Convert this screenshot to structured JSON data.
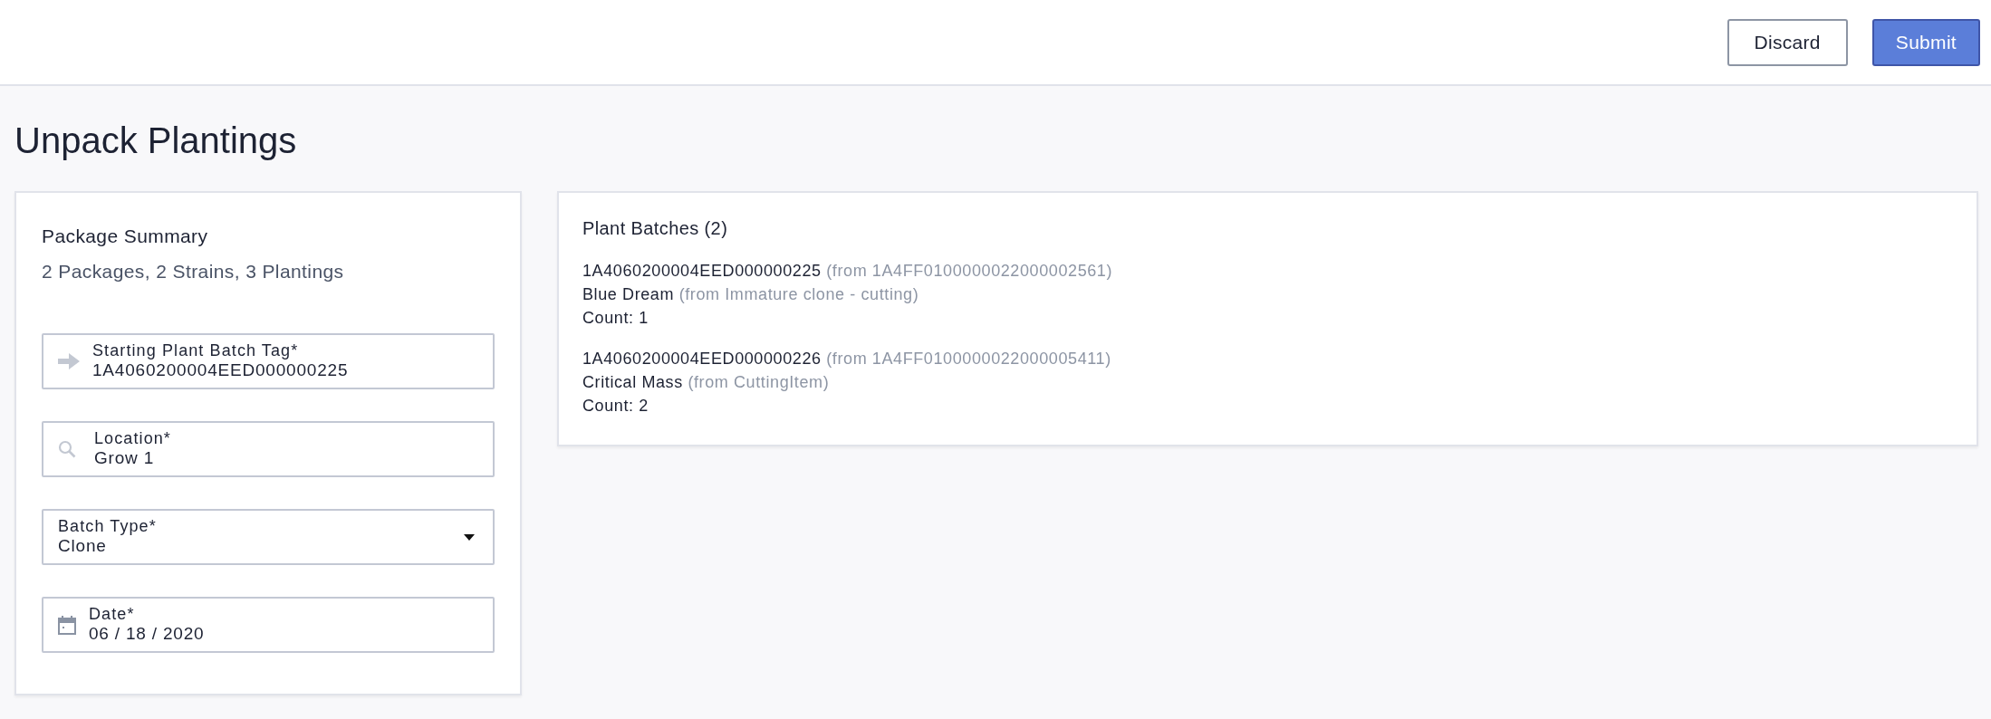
{
  "header": {
    "buttons": [
      {
        "label": "Discard",
        "kind": "secondary"
      },
      {
        "label": "Submit",
        "kind": "primary"
      }
    ]
  },
  "page_title": "Unpack Plantings",
  "package_summary": {
    "title": "Package Summary",
    "summary": "2 Packages, 2 Strains, 3 Plantings",
    "fields": [
      {
        "kind": "arrow",
        "label": "Starting Plant Batch Tag*",
        "value": "1A4060200004EED000000225"
      },
      {
        "kind": "search",
        "label": "Location*",
        "value": "Grow 1"
      },
      {
        "kind": "select",
        "label": "Batch Type*",
        "value": "Clone"
      },
      {
        "kind": "date",
        "label": "Date*",
        "value": "06 / 18 / 2020"
      }
    ]
  },
  "plant_batches": {
    "title": "Plant Batches (2)",
    "items": [
      {
        "tag": "1A4060200004EED000000225",
        "tag_source": "(from 1A4FF0100000022000002561)",
        "strain": "Blue Dream",
        "strain_source": "(from Immature clone - cutting)",
        "count": "Count: 1"
      },
      {
        "tag": "1A4060200004EED000000226",
        "tag_source": "(from 1A4FF0100000022000005411)",
        "strain": "Critical Mass",
        "strain_source": "(from CuttingItem)",
        "count": "Count: 2"
      }
    ]
  }
}
